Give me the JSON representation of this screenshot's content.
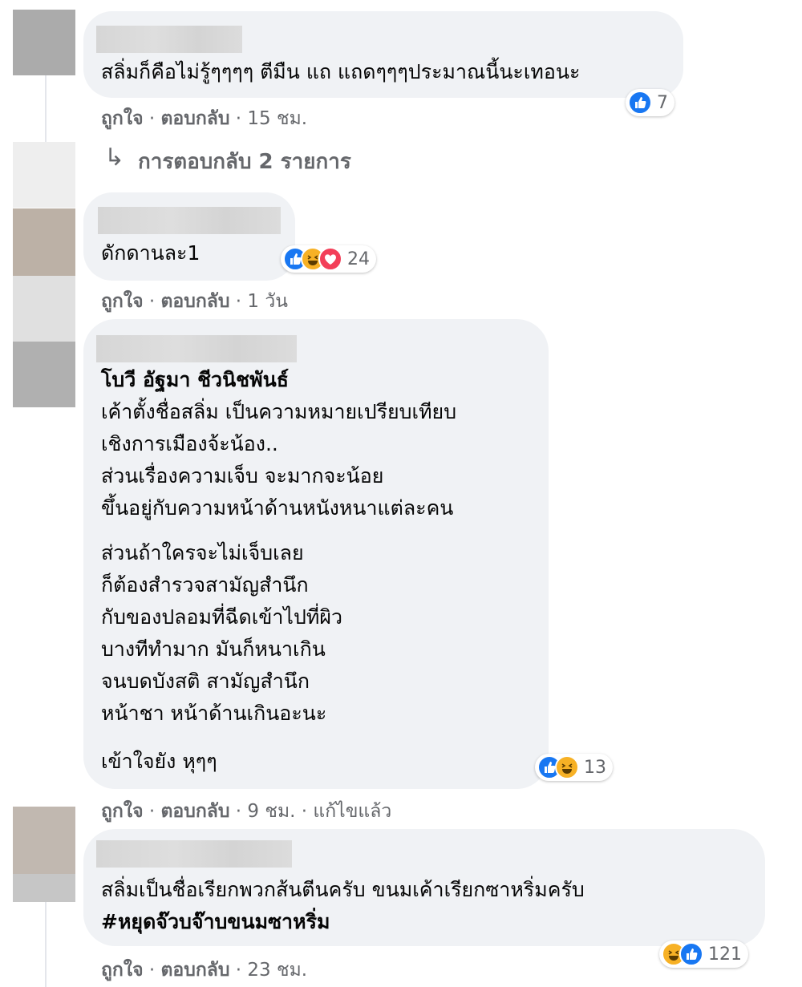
{
  "comments": [
    {
      "text_lines": [
        "สลิ่มก็คือไม่รู้ๆๆๆๆ ตีมืน แถ แถดๆๆๆประมาณนี้นะเทอนะ"
      ],
      "reaction_count": "7",
      "actions": {
        "like": "ถูกใจ",
        "reply": "ตอบกลับ",
        "time": "15 ชม."
      },
      "view_replies": "การตอบกลับ 2 รายการ"
    },
    {
      "text_lines": [
        "ดักดานละ1"
      ],
      "reaction_count": "24",
      "actions": {
        "like": "ถูกใจ",
        "reply": "ตอบกลับ",
        "time": "1 วัน"
      }
    },
    {
      "mention": "โบวี อัฐมา ชีวนิชพันธ์",
      "text_lines": [
        "เค้าตั้งชื่อสลิ่ม เป็นความหมายเปรียบเทียบ",
        "เชิงการเมืองจ้ะน้อง..",
        "ส่วนเรื่องความเจ็บ จะมากจะน้อย",
        "ขึ้นอยู่กับความหน้าด้านหนังหนาแต่ละคน",
        "ส่วนถ้าใครจะไม่เจ็บเลย",
        "ก็ต้องสำรวจสามัญสำนึก",
        "กับของปลอมที่ฉีดเข้าไปที่ผิว",
        "บางทีทำมาก มันก็หนาเกิน",
        "จนบดบังสติ สามัญสำนึก",
        "หน้าชา หน้าด้านเกินอะนะ",
        "เข้าใจยัง หุๆๆ"
      ],
      "reaction_count": "13",
      "actions": {
        "like": "ถูกใจ",
        "reply": "ตอบกลับ",
        "time": "9 ชม.",
        "edited": "แก้ไขแล้ว"
      }
    },
    {
      "text_lines": [
        "สลิ่มเป็นชื่อเรียกพวกส้นตีนครับ ขนมเค้าเรียกซาหริ่มครับ"
      ],
      "hashtag": "#หยุดจ๊วบจ๊าบขนมซาหริ่ม",
      "reaction_count": "121",
      "actions": {
        "like": "ถูกใจ",
        "reply": "ตอบกลับ",
        "time": "23 ชม."
      }
    }
  ],
  "separator": "·",
  "icons": {
    "like": "like-reaction-icon",
    "haha": "haha-reaction-icon",
    "love": "love-reaction-icon",
    "reply_arrow": "reply-arrow-icon"
  },
  "colors": {
    "like": "#1877f2",
    "haha": "#f7b125",
    "love": "#f33e58",
    "bubble": "#f0f2f5",
    "meta": "#65676b"
  }
}
